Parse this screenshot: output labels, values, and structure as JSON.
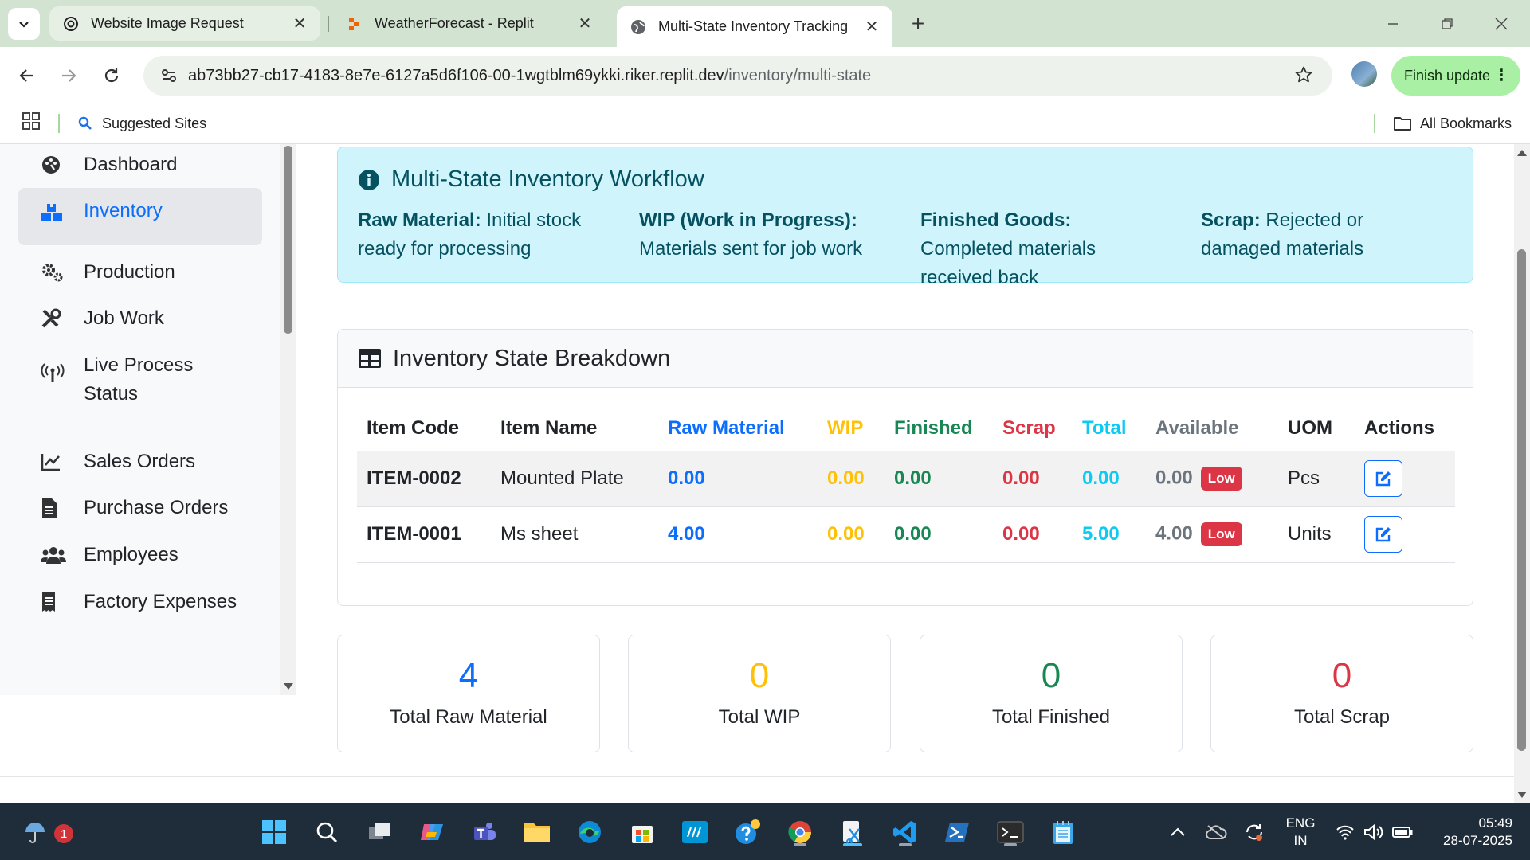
{
  "browser": {
    "tabs": [
      {
        "title": "Website Image Request",
        "active": false
      },
      {
        "title": "WeatherForecast - Replit",
        "active": false
      },
      {
        "title": "Multi-State Inventory Tracking",
        "active": true
      }
    ],
    "url_host": "ab73bb27-cb17-4183-8e7e-6127a5d6f106-00-1wgtblm69ykki.riker.replit.dev",
    "url_path": "/inventory/multi-state",
    "finish_update_label": "Finish update",
    "bookmarks": {
      "suggested_sites": "Suggested Sites",
      "all_bookmarks": "All Bookmarks"
    }
  },
  "sidebar": {
    "items": [
      {
        "label": "Dashboard",
        "icon": "palette-icon"
      },
      {
        "label": "Inventory",
        "icon": "boxes-icon",
        "active": true
      },
      {
        "label": "Production",
        "icon": "gears-icon"
      },
      {
        "label": "Job Work",
        "icon": "tools-icon"
      },
      {
        "label": "Live Process Status",
        "icon": "broadcast-icon"
      },
      {
        "label": "Sales Orders",
        "icon": "chart-line-icon"
      },
      {
        "label": "Purchase Orders",
        "icon": "file-invoice-icon"
      },
      {
        "label": "Employees",
        "icon": "users-icon"
      },
      {
        "label": "Factory Expenses",
        "icon": "receipt-icon"
      }
    ]
  },
  "workflow": {
    "title": "Multi-State Inventory Workflow",
    "states": [
      {
        "name": "Raw Material:",
        "desc": "Initial stock ready for processing"
      },
      {
        "name": "WIP (Work in Progress):",
        "desc": "Materials sent for job work"
      },
      {
        "name": "Finished Goods:",
        "desc": "Completed materials received back"
      },
      {
        "name": "Scrap:",
        "desc": "Rejected or damaged materials"
      }
    ]
  },
  "breakdown": {
    "title": "Inventory State Breakdown",
    "columns": [
      "Item Code",
      "Item Name",
      "Raw Material",
      "WIP",
      "Finished",
      "Scrap",
      "Total",
      "Available",
      "UOM",
      "Actions"
    ],
    "rows": [
      {
        "code": "ITEM-0002",
        "name": "Mounted Plate",
        "raw": "0.00",
        "wip": "0.00",
        "finished": "0.00",
        "scrap": "0.00",
        "total": "0.00",
        "available": "0.00",
        "badge": "Low",
        "uom": "Pcs"
      },
      {
        "code": "ITEM-0001",
        "name": "Ms sheet",
        "raw": "4.00",
        "wip": "0.00",
        "finished": "0.00",
        "scrap": "0.00",
        "total": "5.00",
        "available": "4.00",
        "badge": "Low",
        "uom": "Units"
      }
    ]
  },
  "summary": [
    {
      "value": "4",
      "label": "Total Raw Material",
      "color": "#0d6efd"
    },
    {
      "value": "0",
      "label": "Total WIP",
      "color": "#ffc107"
    },
    {
      "value": "0",
      "label": "Total Finished",
      "color": "#198754"
    },
    {
      "value": "0",
      "label": "Total Scrap",
      "color": "#dc3545"
    }
  ],
  "taskbar": {
    "weather_badge": "1",
    "lang": "ENG",
    "region": "IN",
    "time": "05:49",
    "date": "28-07-2025"
  }
}
